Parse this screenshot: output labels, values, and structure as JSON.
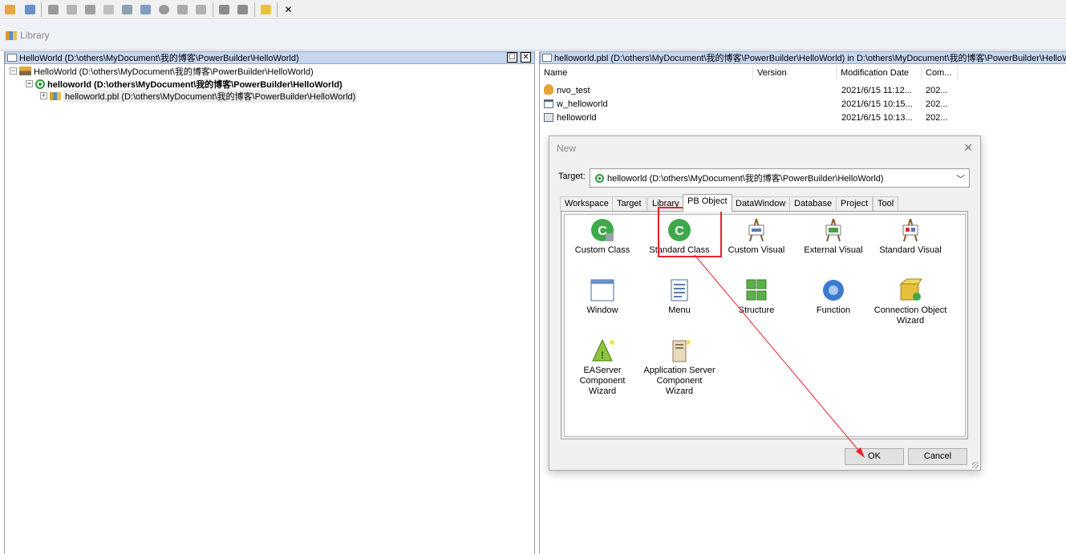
{
  "toolbar": {
    "icons": [
      "new-icon",
      "inherit-icon",
      "open-icon",
      "library-list-icon",
      "run-icon",
      "save-icon",
      "edit-icon",
      "import-icon",
      "export-icon",
      "regenerate-icon",
      "debug-icon",
      "deploy-icon",
      "compare-icon",
      "build-icon",
      "build-all-icon",
      "close-icon"
    ],
    "close_label": "✕"
  },
  "library": {
    "title": "Library"
  },
  "left_pane": {
    "header": "HelloWorld (D:\\others\\MyDocument\\我的博客\\PowerBuilder\\HelloWorld)",
    "tree": [
      {
        "label": "HelloWorld (D:\\others\\MyDocument\\我的博客\\PowerBuilder\\HelloWorld)",
        "expander": "−",
        "level": 0
      },
      {
        "label": "helloworld (D:\\others\\MyDocument\\我的博客\\PowerBuilder\\HelloWorld)",
        "expander": "−",
        "level": 1
      },
      {
        "label": "helloworld.pbl (D:\\others\\MyDocument\\我的博客\\PowerBuilder\\HelloWorld)",
        "expander": "+",
        "level": 2
      }
    ]
  },
  "right_pane": {
    "header": "helloworld.pbl (D:\\others\\MyDocument\\我的博客\\PowerBuilder\\HelloWorld) in D:\\others\\MyDocument\\我的博客\\PowerBuilder\\HelloWo",
    "columns": [
      "Name",
      "Version",
      "Modification Date",
      "Com..."
    ],
    "rows": [
      {
        "icon": "nonvisual-object-icon",
        "name": "nvo_test",
        "version": "",
        "date": "2021/6/15 11:12...",
        "comment": "202..."
      },
      {
        "icon": "window-icon",
        "name": "w_helloworld",
        "version": "",
        "date": "2021/6/15 10:15...",
        "comment": "202..."
      },
      {
        "icon": "application-icon",
        "name": "helloworld",
        "version": "",
        "date": "2021/6/15 10:13...",
        "comment": "202..."
      }
    ]
  },
  "dialog": {
    "title": "New",
    "close": "✕",
    "target_label": "Target:",
    "target_value": "helloworld (D:\\others\\MyDocument\\我的博客\\PowerBuilder\\HelloWorld)",
    "tabs": [
      "Workspace",
      "Target",
      "Library",
      "PB Object",
      "DataWindow",
      "Database",
      "Project",
      "Tool"
    ],
    "active_tab": "PB Object",
    "items": [
      {
        "label": "Custom Class",
        "icon": "custom-class-icon"
      },
      {
        "label": "Standard Class",
        "icon": "standard-class-icon"
      },
      {
        "label": "Custom Visual",
        "icon": "custom-visual-icon"
      },
      {
        "label": "External Visual",
        "icon": "external-visual-icon"
      },
      {
        "label": "Standard Visual",
        "icon": "standard-visual-icon"
      },
      {
        "label": "Window",
        "icon": "window-icon"
      },
      {
        "label": "Menu",
        "icon": "menu-icon"
      },
      {
        "label": "Structure",
        "icon": "structure-icon"
      },
      {
        "label": "Function",
        "icon": "function-icon"
      },
      {
        "label": "Connection Object Wizard",
        "icon": "connection-wizard-icon"
      },
      {
        "label": "EAServer Component Wizard",
        "icon": "easerver-wizard-icon"
      },
      {
        "label": "Application Server Component Wizard",
        "icon": "appserver-wizard-icon"
      }
    ],
    "ok_label": "OK",
    "cancel_label": "Cancel"
  },
  "colors": {
    "accent_red": "#e8222b",
    "header_blue": "#c7d7ee"
  }
}
